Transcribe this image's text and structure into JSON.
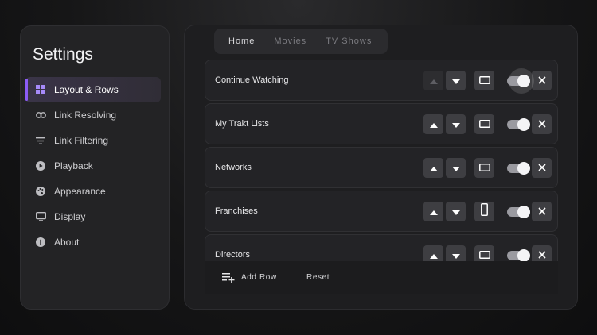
{
  "sidebar": {
    "title": "Settings",
    "items": [
      {
        "label": "Layout & Rows",
        "icon": "grid-icon",
        "active": true
      },
      {
        "label": "Link Resolving",
        "icon": "link-icon"
      },
      {
        "label": "Link Filtering",
        "icon": "filter-icon"
      },
      {
        "label": "Playback",
        "icon": "play-circle-icon"
      },
      {
        "label": "Appearance",
        "icon": "palette-icon"
      },
      {
        "label": "Display",
        "icon": "monitor-icon"
      },
      {
        "label": "About",
        "icon": "info-icon"
      }
    ]
  },
  "tabs": [
    {
      "label": "Home",
      "active": true
    },
    {
      "label": "Movies"
    },
    {
      "label": "TV Shows"
    }
  ],
  "rows": [
    {
      "label": "Continue Watching",
      "up_enabled": false,
      "shape": "landscape",
      "enabled": true,
      "focused": true
    },
    {
      "label": "My Trakt Lists",
      "up_enabled": true,
      "shape": "landscape",
      "enabled": true
    },
    {
      "label": "Networks",
      "up_enabled": true,
      "shape": "landscape",
      "enabled": true
    },
    {
      "label": "Franchises",
      "up_enabled": true,
      "shape": "portrait",
      "enabled": true
    },
    {
      "label": "Directors",
      "up_enabled": true,
      "shape": "landscape",
      "enabled": true
    }
  ],
  "footer": {
    "add_row_label": "Add Row",
    "reset_label": "Reset"
  },
  "colors": {
    "accent": "#8b5cf6"
  }
}
